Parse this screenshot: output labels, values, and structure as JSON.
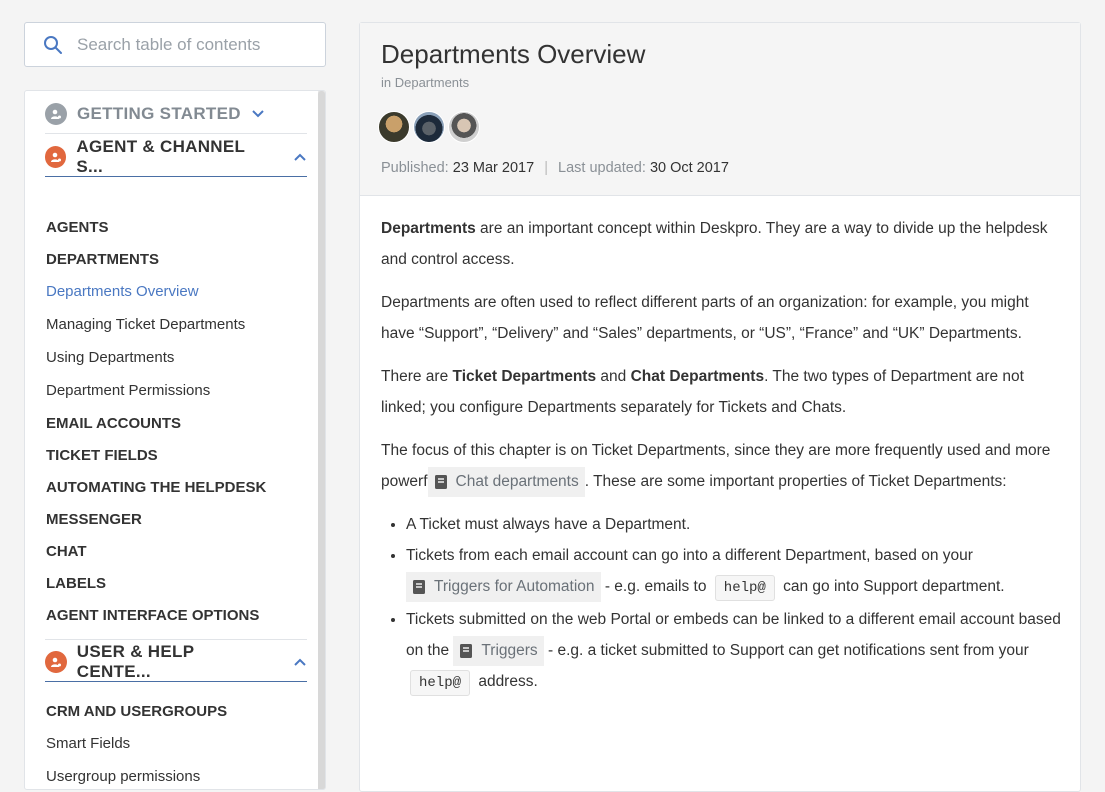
{
  "search": {
    "placeholder": "Search table of contents"
  },
  "toc": {
    "sections": [
      {
        "label": "GETTING STARTED",
        "expanded": false
      },
      {
        "label": "AGENT & CHANNEL S...",
        "expanded": true
      },
      {
        "label": "USER & HELP CENTE...",
        "expanded": true
      }
    ],
    "agent_items": [
      {
        "label": "AGENTS",
        "kind": "category"
      },
      {
        "label": "DEPARTMENTS",
        "kind": "category"
      },
      {
        "label": "Departments Overview",
        "kind": "active"
      },
      {
        "label": "Managing Ticket Departments",
        "kind": "page"
      },
      {
        "label": "Using Departments",
        "kind": "page"
      },
      {
        "label": "Department Permissions",
        "kind": "page"
      },
      {
        "label": "EMAIL ACCOUNTS",
        "kind": "category"
      },
      {
        "label": "TICKET FIELDS",
        "kind": "category"
      },
      {
        "label": "AUTOMATING THE HELPDESK",
        "kind": "category"
      },
      {
        "label": "MESSENGER",
        "kind": "category"
      },
      {
        "label": "CHAT",
        "kind": "category"
      },
      {
        "label": "LABELS",
        "kind": "category"
      },
      {
        "label": "AGENT INTERFACE OPTIONS",
        "kind": "category"
      }
    ],
    "user_items": [
      {
        "label": "CRM AND USERGROUPS",
        "kind": "category"
      },
      {
        "label": "Smart Fields",
        "kind": "page"
      },
      {
        "label": "Usergroup permissions",
        "kind": "page"
      }
    ]
  },
  "article": {
    "title": "Departments Overview",
    "crumb": "in Departments",
    "published_label": "Published:",
    "published_date": "23 Mar 2017",
    "updated_label": "Last updated:",
    "updated_date": "30 Oct 2017",
    "p1_bold": "Departments",
    "p1_rest": " are an important concept within Deskpro. They are a way to divide up the helpdesk and control access.",
    "p2": "Departments are often used to reflect different parts of an organization: for example, you might have “Support”, “Delivery” and “Sales” departments, or “US”, “France” and “UK” Departments.",
    "p3_a": "There are ",
    "p3_b1": "Ticket Departments",
    "p3_c": " and ",
    "p3_b2": "Chat Departments",
    "p3_d": ". The two types of Department are not linked; you configure Departments separately for Tickets and Chats.",
    "p4_a": "The focus of this chapter is on Ticket Departments, since they are more frequently used and more powerf",
    "p4_chip": "Chat departments",
    "p4_b": ". These are some important properties of Ticket Departments:",
    "li1": "A Ticket must always have a Department.",
    "li2_a": "Tickets from each email account can go into a different Department, based on your ",
    "li2_chip": "Triggers for Automation",
    "li2_b": " - e.g. emails to ",
    "li2_code": "help@",
    "li2_c": " can go into Support department.",
    "li3_a": "Tickets submitted on the web Portal or embeds can be linked to a different email account based on the ",
    "li3_chip": "Triggers",
    "li3_b": " - e.g. a ticket submitted to Support can get notifications sent from your ",
    "li3_code": "help@",
    "li3_c": " address."
  },
  "colors": {
    "accent": "#4a78c2",
    "section_icon_orange": "#e1683e",
    "section_icon_gray": "#9aa1a8"
  }
}
